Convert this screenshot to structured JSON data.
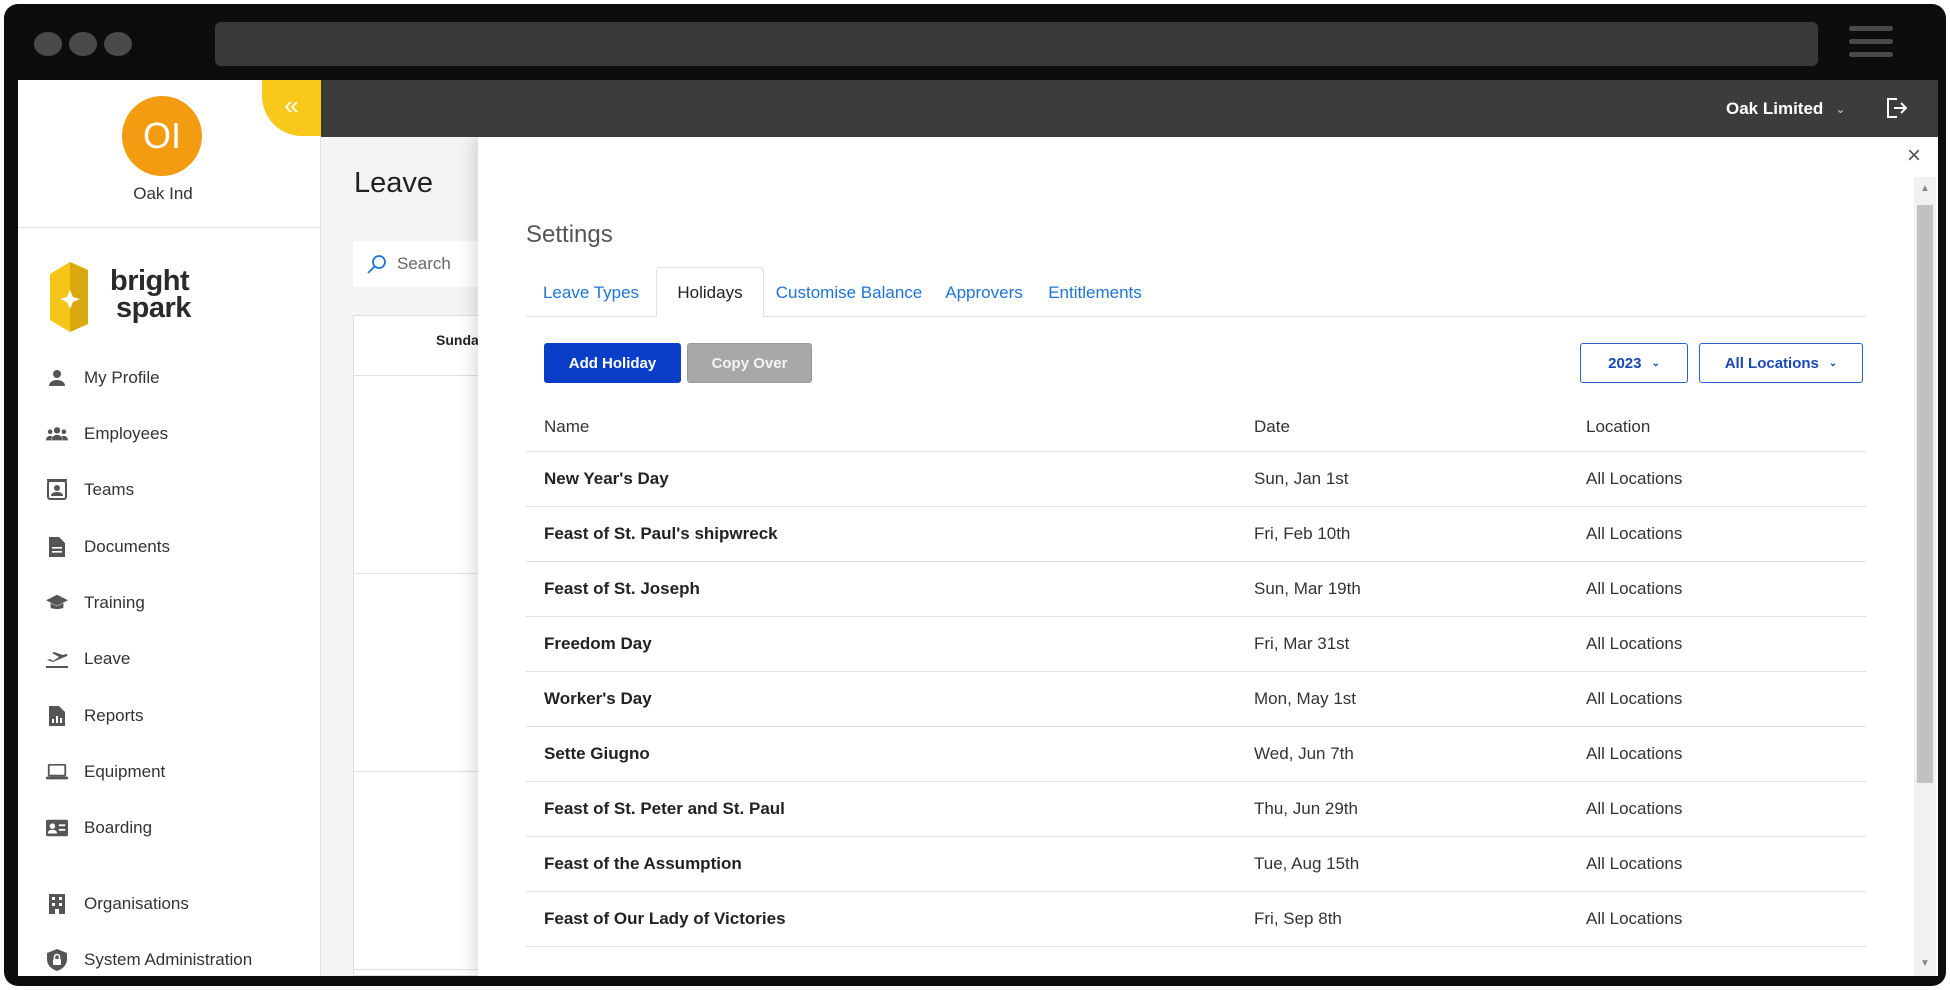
{
  "sidebar": {
    "collapse_icon": "«",
    "avatar_initials": "OI",
    "org_name": "Oak Ind",
    "logo_line1": "bright",
    "logo_line2": "spark",
    "items": [
      {
        "label": "My Profile",
        "icon": "person-icon"
      },
      {
        "label": "Employees",
        "icon": "people-icon"
      },
      {
        "label": "Teams",
        "icon": "teams-icon"
      },
      {
        "label": "Documents",
        "icon": "document-icon"
      },
      {
        "label": "Training",
        "icon": "graduation-cap-icon"
      },
      {
        "label": "Leave",
        "icon": "plane-departure-icon"
      },
      {
        "label": "Reports",
        "icon": "report-icon"
      },
      {
        "label": "Equipment",
        "icon": "laptop-icon"
      },
      {
        "label": "Boarding",
        "icon": "id-card-icon"
      },
      {
        "label": "Organisations",
        "icon": "building-icon"
      },
      {
        "label": "System Administration",
        "icon": "shield-lock-icon"
      }
    ]
  },
  "header": {
    "company": "Oak Limited",
    "company_chevron": "⌄",
    "logout_icon": "logout-icon"
  },
  "background_page": {
    "title": "Leave",
    "search_placeholder": "Search",
    "calendar_first_day": "Sunda"
  },
  "modal": {
    "close_icon": "×",
    "title": "Settings",
    "tabs": [
      "Leave Types",
      "Holidays",
      "Customise Balance",
      "Approvers",
      "Entitlements"
    ],
    "active_tab": "Holidays",
    "add_button": "Add Holiday",
    "copy_button": "Copy Over",
    "year_select": "2023",
    "location_select": "All Locations",
    "table": {
      "headers": [
        "Name",
        "Date",
        "Location"
      ],
      "rows": [
        {
          "name": "New Year's Day",
          "date": "Sun, Jan 1st",
          "location": "All Locations"
        },
        {
          "name": "Feast of St. Paul's shipwreck",
          "date": "Fri, Feb 10th",
          "location": "All Locations"
        },
        {
          "name": "Feast of St. Joseph",
          "date": "Sun, Mar 19th",
          "location": "All Locations"
        },
        {
          "name": "Freedom Day",
          "date": "Fri, Mar 31st",
          "location": "All Locations"
        },
        {
          "name": "Worker's Day",
          "date": "Mon, May 1st",
          "location": "All Locations"
        },
        {
          "name": "Sette Giugno",
          "date": "Wed, Jun 7th",
          "location": "All Locations"
        },
        {
          "name": "Feast of St. Peter and St. Paul",
          "date": "Thu, Jun 29th",
          "location": "All Locations"
        },
        {
          "name": "Feast of the Assumption",
          "date": "Tue, Aug 15th",
          "location": "All Locations"
        },
        {
          "name": "Feast of Our Lady of Victories",
          "date": "Fri, Sep 8th",
          "location": "All Locations"
        }
      ]
    }
  },
  "colors": {
    "avatar": "#f39c12",
    "collapse_tab": "#f8c91a",
    "topbar": "#3c3c3c",
    "primary_button": "#0b3ec8",
    "link_tab": "#1e74d6"
  }
}
